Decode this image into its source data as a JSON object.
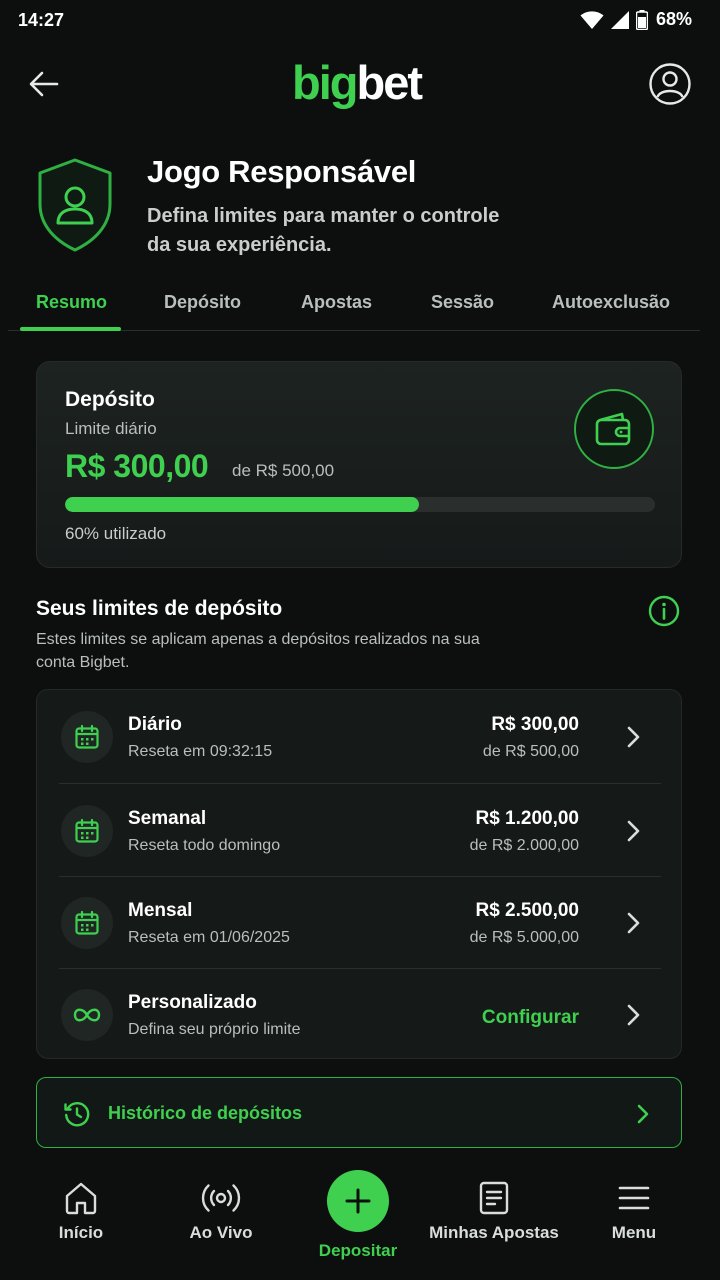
{
  "status_bar": {
    "time": "14:27",
    "battery": "68%"
  },
  "header": {
    "logo_big": "big",
    "logo_bet": "bet"
  },
  "hero": {
    "title": "Jogo Responsável",
    "subtitle": "Defina limites para manter o controle da sua experiência."
  },
  "tabs": [
    {
      "label": "Resumo",
      "active": true
    },
    {
      "label": "Depósito",
      "active": false
    },
    {
      "label": "Apostas",
      "active": false
    },
    {
      "label": "Sessão",
      "active": false
    },
    {
      "label": "Autoexclusão",
      "active": false
    }
  ],
  "summary": {
    "title": "Depósito",
    "subtitle": "Limite diário",
    "amount": "R$ 300,00",
    "of_label": "de R$ 500,00",
    "progress_fraction": 0.6,
    "used_label": "60% utilizado"
  },
  "limits_section": {
    "title": "Seus limites de depósito",
    "description": "Estes limites se aplicam apenas a depósitos realizados na sua conta Bigbet.",
    "rows": [
      {
        "icon": "calendar-icon",
        "name": "Diário",
        "note": "Reseta em 09:32:15",
        "amount": "R$ 300,00",
        "of": "de R$ 500,00"
      },
      {
        "icon": "calendar-icon",
        "name": "Semanal",
        "note": "Reseta todo domingo",
        "amount": "R$ 1.200,00",
        "of": "de R$ 2.000,00"
      },
      {
        "icon": "calendar-icon",
        "name": "Mensal",
        "note": "Reseta em 01/06/2025",
        "amount": "R$ 2.500,00",
        "of": "de R$ 5.000,00"
      },
      {
        "icon": "infinity-icon",
        "name": "Personalizado",
        "note": "Defina seu próprio limite",
        "action": "Configurar"
      }
    ]
  },
  "history": {
    "label": "Histórico de depósitos"
  },
  "bottom_nav": {
    "items": [
      {
        "label": "Início",
        "icon": "home-icon"
      },
      {
        "label": "Ao Vivo",
        "icon": "live-broadcast-icon"
      },
      {
        "label": "Depositar",
        "icon": "plus-icon"
      },
      {
        "label": "Minhas Apostas",
        "icon": "document-icon"
      },
      {
        "label": "Menu",
        "icon": "hamburger-menu-icon"
      }
    ]
  },
  "colors": {
    "accent": "#3fd050",
    "background": "#0c0f0e",
    "card": "#151918"
  }
}
